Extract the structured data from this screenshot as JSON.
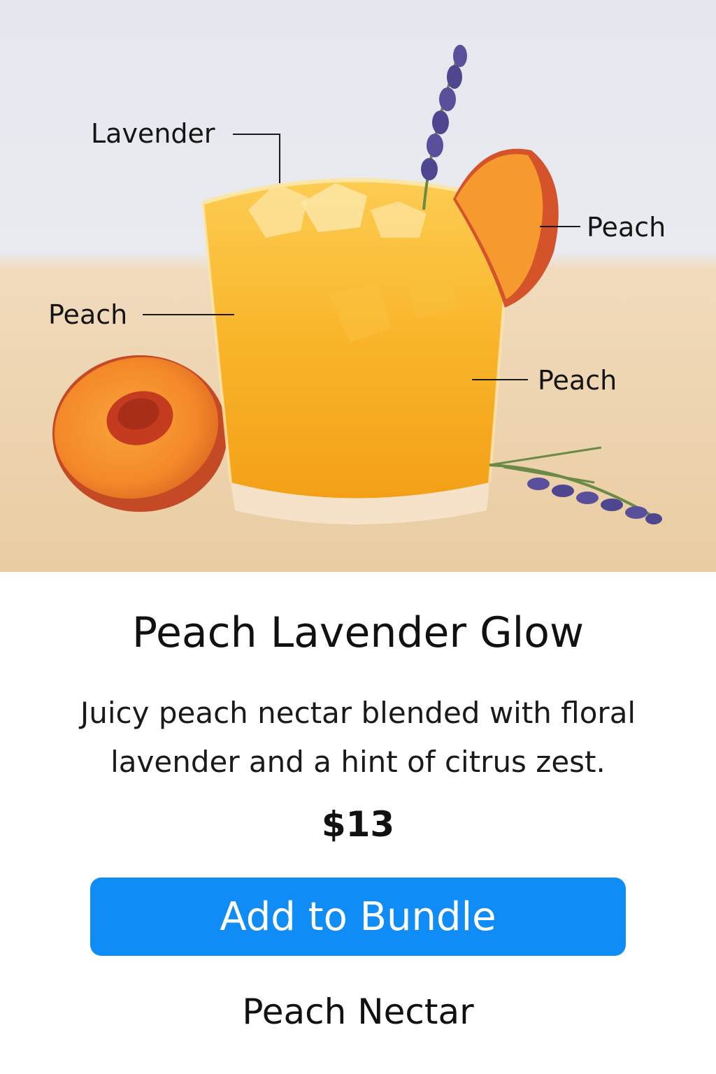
{
  "hero": {
    "callouts": {
      "lavender": "Lavender",
      "peach_top_right": "Peach",
      "peach_left": "Peach",
      "peach_right": "Peach"
    }
  },
  "product": {
    "title": "Peach Lavender Glow",
    "description": "Juicy peach nectar blended with floral lavender and a hint of citrus zest.",
    "price": "$13",
    "add_button_label": "Add to Bundle",
    "subtitle": "Peach Nectar"
  },
  "colors": {
    "accent": "#0f8cf6",
    "juice": "#f7ad22",
    "peach_skin": "#e8652f",
    "lavender": "#5a4f9a"
  }
}
